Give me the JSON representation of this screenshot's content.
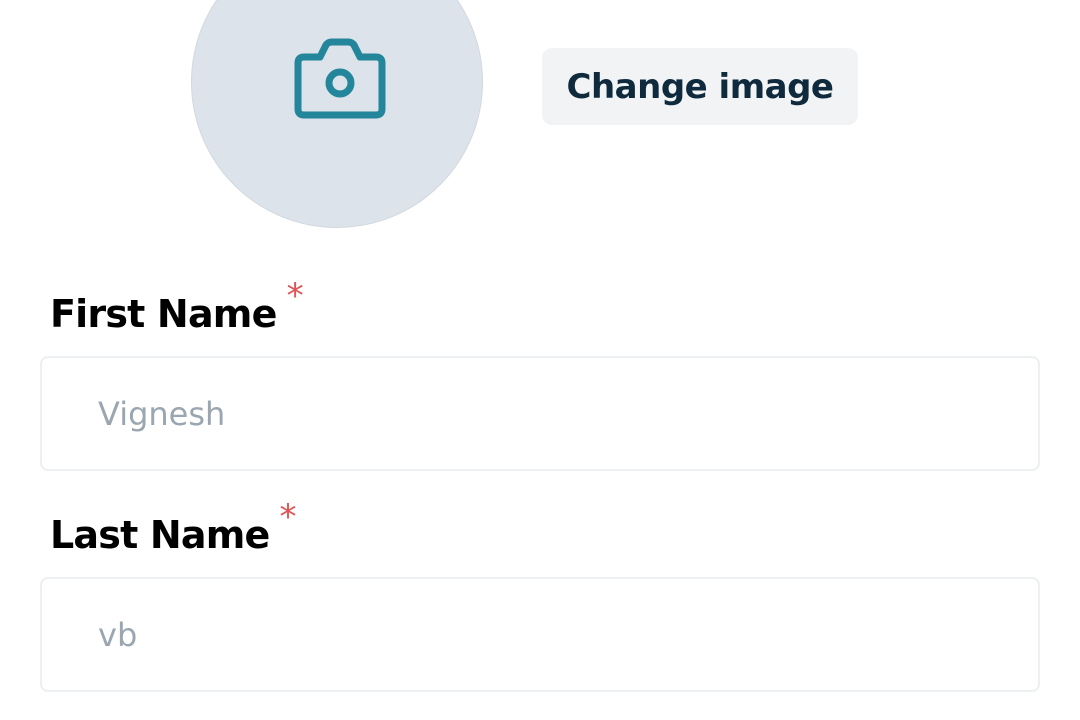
{
  "profile": {
    "avatar_icon": "camera-icon",
    "change_image_label": "Change image"
  },
  "form": {
    "first_name": {
      "label": "First Name",
      "required_mark": "*",
      "placeholder": "Vignesh",
      "value": ""
    },
    "last_name": {
      "label": "Last Name",
      "required_mark": "*",
      "placeholder": "vb",
      "value": ""
    }
  },
  "colors": {
    "accent": "#23869a",
    "required": "#e05353",
    "avatar_bg": "#dde3ea",
    "button_bg": "#f1f3f5",
    "button_text": "#0f2a3d",
    "placeholder": "#9aa6b0"
  }
}
